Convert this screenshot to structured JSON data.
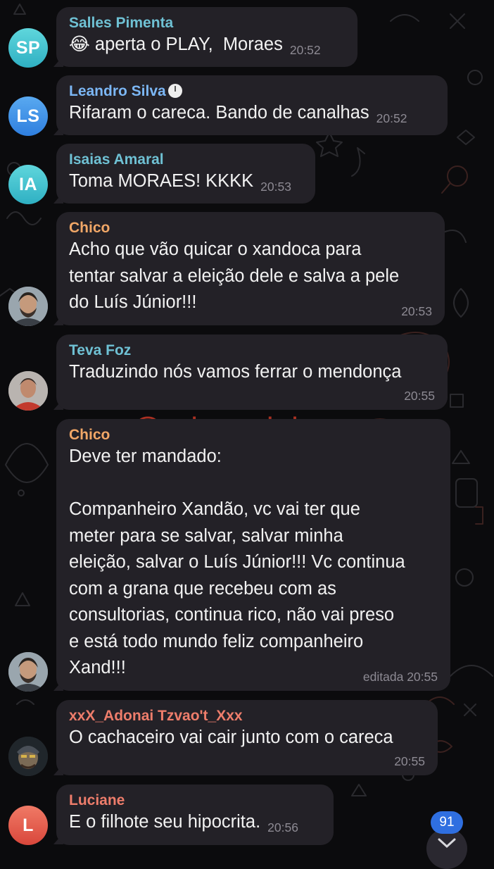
{
  "watermark": "@printsminions",
  "messages": [
    {
      "initials": "SP",
      "sender": "Salles Pimenta",
      "emoji": "😂",
      "text": " aperta o PLAY,  Moraes",
      "time": "20:52"
    },
    {
      "initials": "LS",
      "sender": "Leandro Silva",
      "text": "Rifaram o careca. Bando de canalhas",
      "time": "20:52"
    },
    {
      "initials": "IA",
      "sender": "Isaias Amaral",
      "text": "Toma MORAES! KKKK",
      "time": "20:53"
    },
    {
      "sender": "Chico",
      "text": "Acho que vão quicar o xandoca para\ntentar salvar a eleição dele e salva a pele\ndo Luís Júnior!!!",
      "time": "20:53"
    },
    {
      "sender": "Teva Foz",
      "text": "Traduzindo nós vamos ferrar o mendonça",
      "time": "20:55"
    },
    {
      "sender": "Chico",
      "text": "Deve ter mandado:\n\nCompanheiro Xandão, vc vai ter que\nmeter para se salvar, salvar minha\neleição, salvar o Luís Júnior!!! Vc continua\ncom a grana que recebeu com as\nconsultorias, continua rico, não vai preso\ne está todo mundo feliz companheiro\nXand!!!",
      "time": "editada 20:55"
    },
    {
      "sender": "xxX_Adonai Tzvao't_Xxx",
      "text": "O cachaceiro vai cair junto com o careca",
      "time": "20:55"
    },
    {
      "initials": "L",
      "sender": "Luciane",
      "text": "E o filhote seu hipocrita.",
      "time": "20:56"
    }
  ],
  "unread_count": "91",
  "colors": {
    "sp": "#3fc4cf",
    "ls": "#3e8fe6",
    "ia": "#3fc4cf",
    "l": "#e05a4a",
    "name_cyan": "#6fc1d4",
    "name_blue": "#7cb7f5",
    "name_orange": "#f1a767",
    "name_red": "#ee7d6b"
  }
}
